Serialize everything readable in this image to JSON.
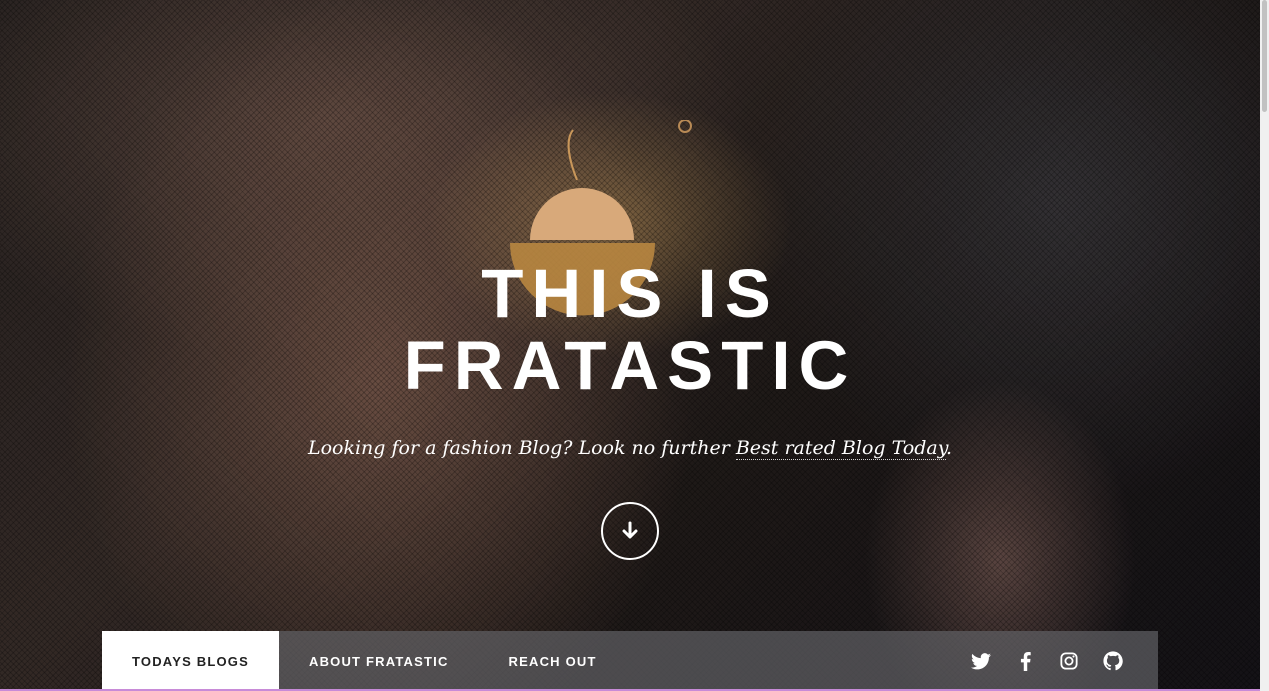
{
  "hero": {
    "title_line1": "THIS IS",
    "title_line2": "FRATASTIC",
    "tagline_text": "Looking for a fashion Blog? Look no further ",
    "tagline_link": "Best rated Blog Today",
    "tagline_end": "."
  },
  "nav": {
    "items": [
      {
        "label": "TODAYS BLOGS",
        "active": true
      },
      {
        "label": "ABOUT FRATASTIC",
        "active": false
      },
      {
        "label": "REACH OUT",
        "active": false
      }
    ],
    "social_icons": [
      "twitter-icon",
      "facebook-icon",
      "instagram-icon",
      "github-icon"
    ]
  },
  "colors": {
    "nav_background": "#5f5f64",
    "active_tab": "#ffffff",
    "text": "#ffffff"
  }
}
